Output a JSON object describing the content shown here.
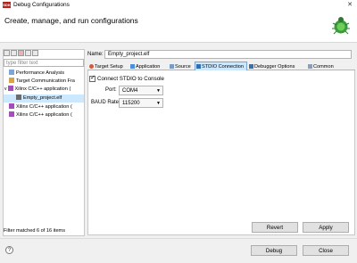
{
  "window": {
    "title": "Debug Configurations"
  },
  "header": {
    "title": "Create, manage, and run configurations"
  },
  "left": {
    "filter_placeholder": "type filter text",
    "tree": [
      {
        "label": "Performance Analysis",
        "icon": "profile-icon",
        "selected": false
      },
      {
        "label": "Target Communication Fra",
        "icon": "target-icon",
        "selected": false
      },
      {
        "label": "Xilinx C/C++ application (",
        "icon": "xilinx-app-icon",
        "selected": false,
        "expand": "v"
      },
      {
        "label": "Empty_project.elf",
        "icon": "elf-icon",
        "selected": true
      },
      {
        "label": "Xilinx C/C++ application (",
        "icon": "xilinx-app-icon",
        "selected": false
      },
      {
        "label": "Xilinx C/C++ application (",
        "icon": "xilinx-app-icon",
        "selected": false
      }
    ],
    "status": "Filter matched 6 of 16 items"
  },
  "main": {
    "name_label": "Name:",
    "name_value": "Empty_project.elf",
    "tabs": [
      {
        "label": "Target Setup",
        "icon": "target-setup-icon"
      },
      {
        "label": "Application",
        "icon": "application-icon"
      },
      {
        "label": "Source",
        "icon": "source-icon"
      },
      {
        "label": "STDIO Connection",
        "icon": "stdio-icon",
        "active": true
      },
      {
        "label": "Debugger Options",
        "icon": "debugger-options-icon"
      },
      {
        "label": "Common",
        "icon": "common-icon"
      }
    ],
    "connect_label": "Connect STDIO to Console",
    "connect_checked": true,
    "port_label": "Port:",
    "port_value": "COM4",
    "baud_label": "BAUD Rate:",
    "baud_value": "115200",
    "revert_label": "Revert",
    "apply_label": "Apply"
  },
  "footer": {
    "help": "?",
    "debug_label": "Debug",
    "close_label": "Close"
  },
  "colors": {
    "accent": "#cce8ff",
    "app_icon": "#b3261e",
    "bug": "#3c9a3c"
  }
}
